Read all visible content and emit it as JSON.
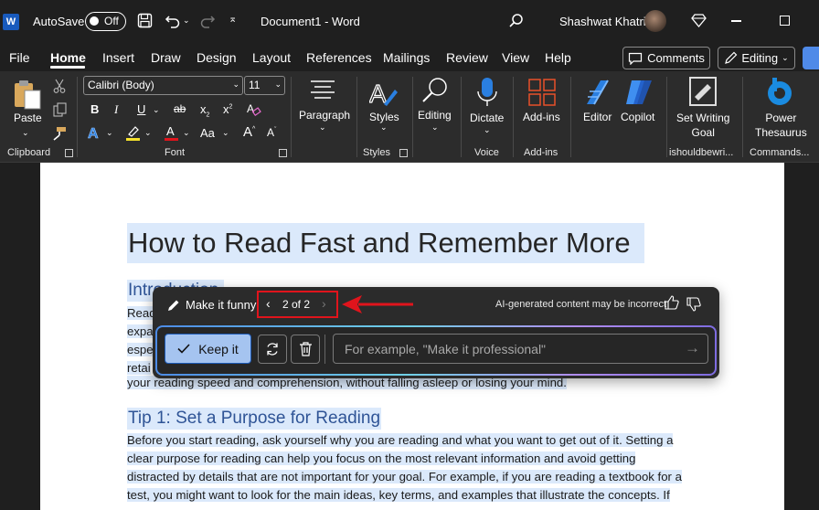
{
  "titlebar": {
    "app_icon": "W",
    "autosave_label": "AutoSave",
    "autosave_state": "Off",
    "doc_title": "Document1 - Word",
    "user_name": "Shashwat Khatri"
  },
  "menu": {
    "tabs": [
      "File",
      "Home",
      "Insert",
      "Draw",
      "Design",
      "Layout",
      "References",
      "Mailings",
      "Review",
      "View",
      "Help"
    ],
    "active_tab": "Home",
    "comments_label": "Comments",
    "editing_label": "Editing"
  },
  "ribbon": {
    "paste_label": "Paste",
    "clipboard_label": "Clipboard",
    "font_name": "Calibri (Body)",
    "font_size": "11",
    "font_label": "Font",
    "bold": "B",
    "italic": "I",
    "underline": "U",
    "strike": "ab",
    "subscript": "x",
    "superscript": "x",
    "change_case": "Aa",
    "grow_font": "A",
    "shrink_font": "A",
    "paragraph_label": "Paragraph",
    "styles_label": "Styles",
    "styles_group_label": "Styles",
    "editing_label": "Editing",
    "dictate_label": "Dictate",
    "voice_label": "Voice",
    "addins_label": "Add-ins",
    "addins_group_label": "Add-ins",
    "editor_label": "Editor",
    "copilot_label": "Copilot",
    "set_writing_goal_line1": "Set Writing",
    "set_writing_goal_line2": "Goal",
    "ishouldbewriting_label": "ishouldbewri...",
    "power_thesaurus_line1": "Power",
    "power_thesaurus_line2": "Thesaurus",
    "commands_label": "Commands...",
    "accent_colors": {
      "highlight": "#f5e12c",
      "font_color": "#e0141c"
    }
  },
  "document": {
    "title": "How to Read Fast and Remember More",
    "intro_heading_visible": "Introduction",
    "intro_lines": [
      "Read",
      "expa",
      "espe",
      "retai"
    ],
    "intro_last_line": "your reading speed and comprehension, without falling asleep or losing your mind.",
    "tip1_heading": "Tip 1: Set a Purpose for Reading",
    "tip1_lines": [
      "Before you start reading, ask yourself why you are reading and what you want to get out of it. Setting a",
      "clear purpose for reading can help you focus on the most relevant information and avoid getting",
      "distracted by details that are not important for your goal. For example, if you are reading a textbook for a",
      "test, you might want to look for the main ideas, key terms, and examples that illustrate the concepts. If"
    ]
  },
  "copilot_panel": {
    "prompt_title": "Make it funny",
    "nav_count": "2 of 2",
    "ai_note": "AI-generated content may be incorrect",
    "keep_label": "Keep it",
    "input_placeholder": "For example, \"Make it professional\""
  },
  "colors": {
    "annotation_red": "#e0141c",
    "keep_button": "#a5c4f0",
    "selection_highlight": "#dbe9fb",
    "heading_blue": "#2f5496"
  }
}
